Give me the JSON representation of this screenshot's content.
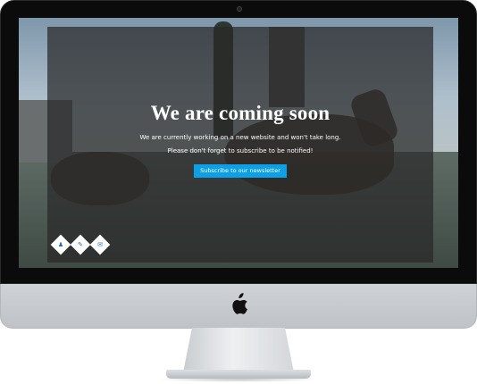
{
  "page": {
    "title": "We are coming soon",
    "line1": "We are currently working on a new website and won't take long.",
    "line2": "Please don't forget to subscribe to be notified!",
    "cta_label": "Subscribe to our newsletter"
  },
  "social": [
    {
      "icon": "person-icon",
      "glyph": "♟"
    },
    {
      "icon": "pencil-icon",
      "glyph": "✎"
    },
    {
      "icon": "mail-icon",
      "glyph": "✉"
    }
  ],
  "colors": {
    "accent": "#0ea0e6",
    "overlay": "#282828",
    "text": "#ffffff",
    "bezel": "#0b0b0b"
  }
}
